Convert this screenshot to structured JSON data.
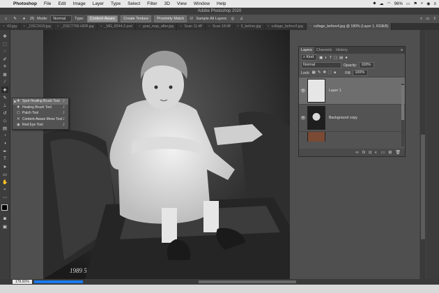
{
  "menubar": {
    "app_name": "Photoshop",
    "items": [
      "File",
      "Edit",
      "Image",
      "Layer",
      "Type",
      "Select",
      "Filter",
      "3D",
      "View",
      "Window",
      "Help"
    ],
    "battery": "96%",
    "right_icons": [
      "dropbox-icon",
      "creative-cloud-icon",
      "wifi-icon",
      "battery-icon",
      "flag-icon",
      "search-icon",
      "siri-icon",
      "menu-icon"
    ]
  },
  "window_title": "Adobe Photoshop 2020",
  "options_bar": {
    "brush_size": "25",
    "mode_label": "Mode:",
    "mode_value": "Normal",
    "type_label": "Type:",
    "type_content_aware": "Content-Aware",
    "type_create_texture": "Create Texture",
    "type_proximity_match": "Proximity Match",
    "sample_all_layers": "Sample All Layers"
  },
  "document_tabs": [
    {
      "label": "43.jpg",
      "active": false
    },
    {
      "label": "_DSC2419.jpg",
      "active": false
    },
    {
      "label": "_DSC7706-HDR.jpg",
      "active": false
    },
    {
      "label": "_MG_8244-2.psd",
      "active": false
    },
    {
      "label": "goat_map_after.jpg",
      "active": false
    },
    {
      "label": "Scan 11.tiff",
      "active": false
    },
    {
      "label": "Scan 18.tiff",
      "active": false
    },
    {
      "label": "5_before.jpg",
      "active": false
    },
    {
      "label": "collage_before3.jpg",
      "active": false
    },
    {
      "label": "collage_before4.jpg @ 180% (Layer 1, RGB/8)",
      "active": true
    }
  ],
  "tool_flyout": [
    {
      "label": "Spot Healing Brush Tool",
      "key": "J",
      "active": true,
      "icon": "spot-healing-icon"
    },
    {
      "label": "Healing Brush Tool",
      "key": "J",
      "active": false,
      "icon": "healing-brush-icon"
    },
    {
      "label": "Patch Tool",
      "key": "J",
      "active": false,
      "icon": "patch-icon"
    },
    {
      "label": "Content-Aware Move Tool",
      "key": "J",
      "active": false,
      "icon": "content-aware-move-icon"
    },
    {
      "label": "Red Eye Tool",
      "key": "J",
      "active": false,
      "icon": "red-eye-icon"
    }
  ],
  "layers_panel": {
    "tabs": [
      "Layers",
      "Channels",
      "History"
    ],
    "filter_kind": "Kind",
    "blend_mode": "Normal",
    "opacity_label": "Opacity:",
    "opacity_value": "100%",
    "lock_label": "Lock:",
    "fill_label": "Fill:",
    "fill_value": "100%",
    "layers": [
      {
        "name": "Layer 1",
        "visible": true,
        "active": true,
        "thumb_color": "#e6e6e6"
      },
      {
        "name": "Background copy",
        "visible": true,
        "active": false,
        "thumb_color": "#1e1e1e"
      },
      {
        "name": "",
        "visible": false,
        "active": false,
        "thumb_color": "#7a4a35"
      }
    ]
  },
  "status": {
    "zoom": "179.91%"
  },
  "photo_caption": "1989 5",
  "colors": {
    "accent_blue": "#1a7bf0"
  }
}
